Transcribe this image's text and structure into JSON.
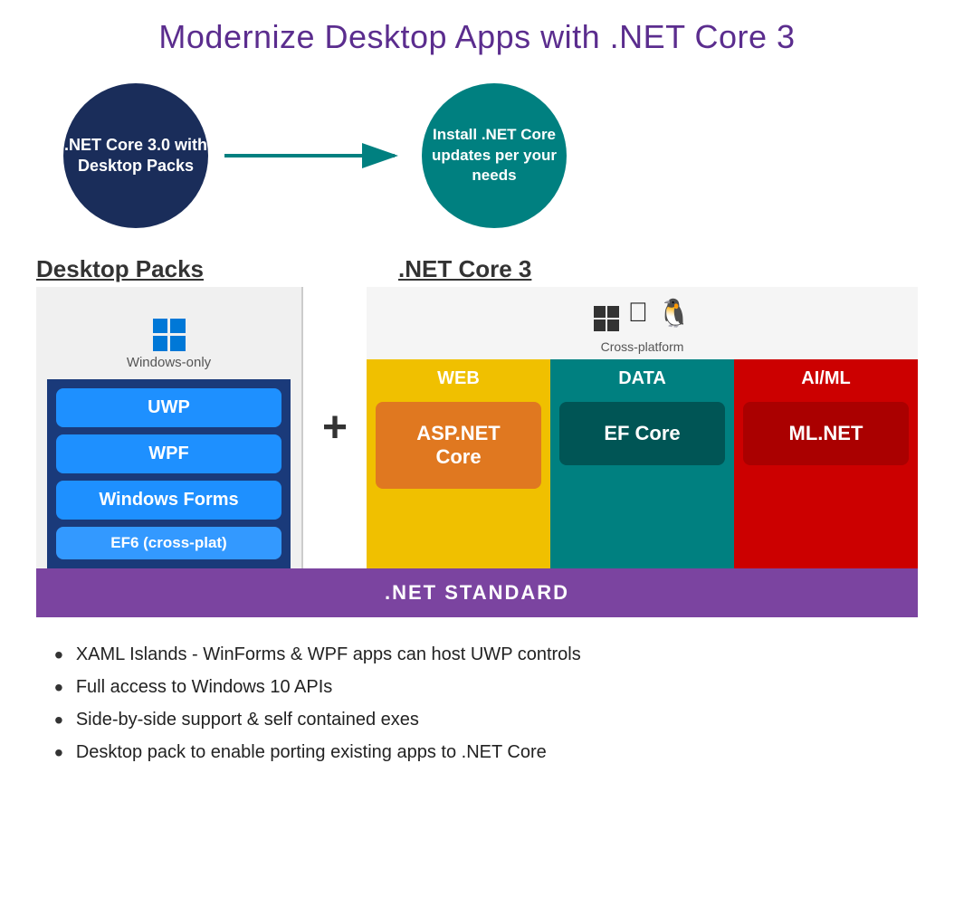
{
  "title": "Modernize Desktop Apps with .NET Core 3",
  "diagram": {
    "circle_left": ".NET Core 3.0 with Desktop Packs",
    "circle_right": "Install .NET Core updates per your needs",
    "label_desktop": "Desktop Packs",
    "label_netcore": ".NET Core 3",
    "windows_only": "Windows-only",
    "cross_platform": "Cross-platform",
    "buttons": {
      "uwp": "UWP",
      "wpf": "WPF",
      "winforms": "Windows Forms",
      "ef6": "EF6 (cross-plat)"
    },
    "web_header": "WEB",
    "data_header": "DATA",
    "ai_header": "AI/ML",
    "aspnet": "ASP.NET Core",
    "efcore": "EF Core",
    "mlnet": "ML.NET",
    "net_standard": ".NET STANDARD"
  },
  "bullets": [
    "XAML Islands - WinForms & WPF apps can host UWP controls",
    "Full access to Windows 10 APIs",
    "Side-by-side support & self contained exes",
    "Desktop pack to enable porting existing apps to .NET Core"
  ]
}
